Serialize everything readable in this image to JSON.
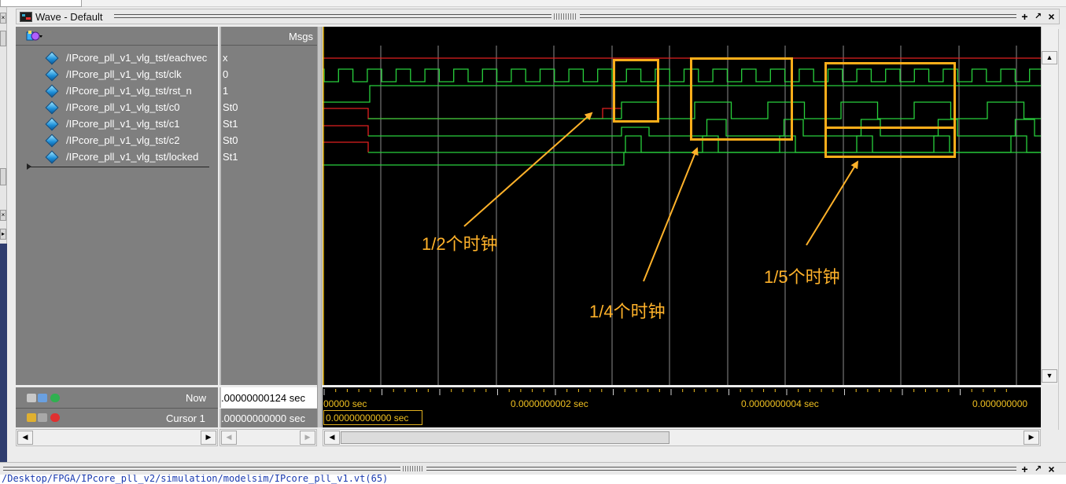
{
  "window": {
    "title": "Wave - Default",
    "grip": ":::::::",
    "buttons": [
      "+",
      "↗",
      "×"
    ]
  },
  "header": {
    "msgs_label": "Msgs",
    "icon": "wave-tools-icon"
  },
  "signals": [
    {
      "name": "/IPcore_pll_v1_vlg_tst/eachvec",
      "value": "x"
    },
    {
      "name": "/IPcore_pll_v1_vlg_tst/clk",
      "value": "0"
    },
    {
      "name": "/IPcore_pll_v1_vlg_tst/rst_n",
      "value": "1"
    },
    {
      "name": "/IPcore_pll_v1_vlg_tst/c0",
      "value": "St0"
    },
    {
      "name": "/IPcore_pll_v1_vlg_tst/c1",
      "value": "St1"
    },
    {
      "name": "/IPcore_pll_v1_vlg_tst/c2",
      "value": "St0"
    },
    {
      "name": "/IPcore_pll_v1_vlg_tst/locked",
      "value": "St1"
    }
  ],
  "footer": {
    "now_label": "Now",
    "now_value": ".00000000124 sec",
    "cursor_label": "Cursor 1",
    "cursor_value": ".00000000000 sec",
    "cursor_box": "0.00000000000 sec"
  },
  "ruler": {
    "labels": [
      "00000 sec",
      "0.0000000002 sec",
      "0.0000000004 sec",
      "0.000000000"
    ]
  },
  "annotations": [
    {
      "label": "1/2个时钟"
    },
    {
      "label": "1/4个时钟"
    },
    {
      "label": "1/5个时钟"
    }
  ],
  "colors": {
    "signal_green": "#28d03c",
    "signal_red": "#e02020",
    "annotation": "#ffb22a",
    "cursor": "#f0c020"
  },
  "bottom": {
    "path_text": "/Desktop/FPGA/IPcore_pll_v2/simulation/modelsim/IPcore_pll_v1.vt(65)",
    "buttons": [
      "+",
      "↗",
      "×"
    ]
  }
}
